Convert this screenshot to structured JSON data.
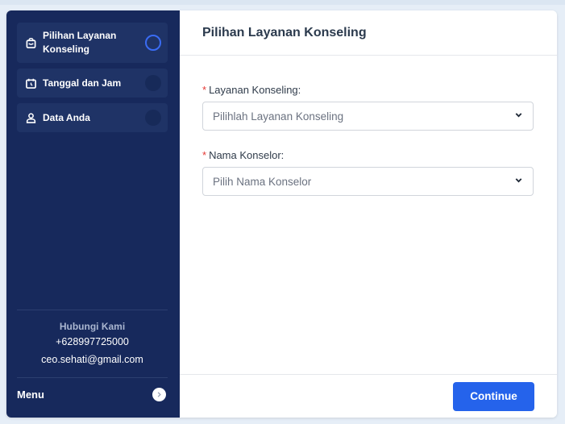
{
  "sidebar": {
    "steps": [
      {
        "label": "Pilihan Layanan Konseling",
        "icon": "shopping-bag-icon",
        "active": true
      },
      {
        "label": "Tanggal dan Jam",
        "icon": "calendar-clock-icon",
        "active": false
      },
      {
        "label": "Data Anda",
        "icon": "user-icon",
        "active": false
      }
    ],
    "contact": {
      "title": "Hubungi Kami",
      "phone": "+628997725000",
      "email": "ceo.sehati@gmail.com"
    },
    "menu_label": "Menu"
  },
  "main": {
    "title": "Pilihan Layanan Konseling",
    "fields": [
      {
        "label": "Layanan Konseling:",
        "required_mark": "*",
        "placeholder": "Pilihlah Layanan Konseling"
      },
      {
        "label": "Nama Konselor:",
        "required_mark": "*",
        "placeholder": "Pilih Nama Konselor"
      }
    ],
    "continue_label": "Continue"
  },
  "colors": {
    "sidebar_bg": "#17295c",
    "accent": "#2563eb",
    "active_ring": "#3a6cf4",
    "required": "#e53935"
  }
}
